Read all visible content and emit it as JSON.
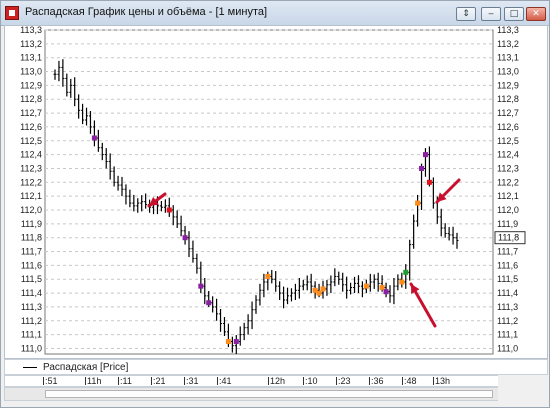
{
  "window": {
    "title": "Распадская График цены и объёма - [1 минута]",
    "buttons": [
      "⇕",
      "‒",
      "□",
      "✕"
    ]
  },
  "y_axis": {
    "ticks": [
      "113,3",
      "113,2",
      "113,1",
      "113,0",
      "112,9",
      "112,8",
      "112,7",
      "112,6",
      "112,5",
      "112,4",
      "112,3",
      "112,2",
      "112,1",
      "112,0",
      "111,9",
      "111,8",
      "111,7",
      "111,6",
      "111,5",
      "111,4",
      "111,3",
      "111,2",
      "111,1",
      "111,0"
    ],
    "current_price": "111,8"
  },
  "legend": {
    "label": "Распадская [Price]"
  },
  "time_axis": {
    "labels": [
      ":51",
      "11h",
      ":11",
      ":21",
      ":31",
      ":41",
      "12h",
      ":10",
      ":23",
      ":36",
      ":48",
      "13h"
    ]
  },
  "colors": {
    "grid": "#c8c8c8",
    "bar": "#000000",
    "arrow": "#c8102e",
    "marker_orange": "#ff8c1a",
    "marker_purple": "#8b1fa3",
    "marker_red": "#e0121c",
    "marker_green": "#1e9e2d"
  },
  "chart_data": {
    "type": "ohlc",
    "ylim": [
      110.96,
      113.3
    ],
    "values": [
      112.98,
      113.03,
      112.95,
      112.85,
      112.9,
      112.8,
      112.72,
      112.65,
      112.68,
      112.6,
      112.52,
      112.45,
      112.4,
      112.35,
      112.28,
      112.2,
      112.18,
      112.15,
      112.1,
      112.05,
      112.03,
      112.05,
      112.06,
      112.04,
      112.02,
      112.04,
      112.03,
      112.02,
      112.03,
      112.0,
      111.95,
      111.9,
      111.85,
      111.8,
      111.72,
      111.65,
      111.58,
      111.45,
      111.38,
      111.33,
      111.3,
      111.25,
      111.18,
      111.12,
      111.05,
      111.02,
      111.05,
      111.1,
      111.15,
      111.2,
      111.28,
      111.35,
      111.42,
      111.48,
      111.52,
      111.5,
      111.45,
      111.4,
      111.35,
      111.38,
      111.4,
      111.42,
      111.45,
      111.46,
      111.48,
      111.45,
      111.42,
      111.4,
      111.43,
      111.46,
      111.48,
      111.52,
      111.5,
      111.46,
      111.42,
      111.44,
      111.47,
      111.45,
      111.43,
      111.45,
      111.48,
      111.5,
      111.47,
      111.44,
      111.41,
      111.38,
      111.45,
      111.5,
      111.48,
      111.55,
      111.75,
      111.92,
      112.05,
      112.3,
      112.4,
      112.2,
      112.05,
      111.95,
      111.87,
      111.83,
      111.82,
      111.8,
      111.78
    ],
    "markers": [
      {
        "i": 10,
        "color": "purple"
      },
      {
        "i": 29,
        "color": "red"
      },
      {
        "i": 33,
        "color": "purple"
      },
      {
        "i": 37,
        "color": "purple"
      },
      {
        "i": 39,
        "color": "purple"
      },
      {
        "i": 44,
        "color": "orange"
      },
      {
        "i": 46,
        "color": "purple"
      },
      {
        "i": 54,
        "color": "orange"
      },
      {
        "i": 66,
        "color": "orange"
      },
      {
        "i": 67,
        "color": "orange"
      },
      {
        "i": 68,
        "color": "orange"
      },
      {
        "i": 79,
        "color": "orange"
      },
      {
        "i": 83,
        "color": "orange"
      },
      {
        "i": 84,
        "color": "purple"
      },
      {
        "i": 88,
        "color": "orange"
      },
      {
        "i": 89,
        "color": "green"
      },
      {
        "i": 92,
        "color": "orange"
      },
      {
        "i": 93,
        "color": "purple"
      },
      {
        "i": 95,
        "color": "red"
      },
      {
        "i": 94,
        "color": "purple"
      }
    ]
  }
}
